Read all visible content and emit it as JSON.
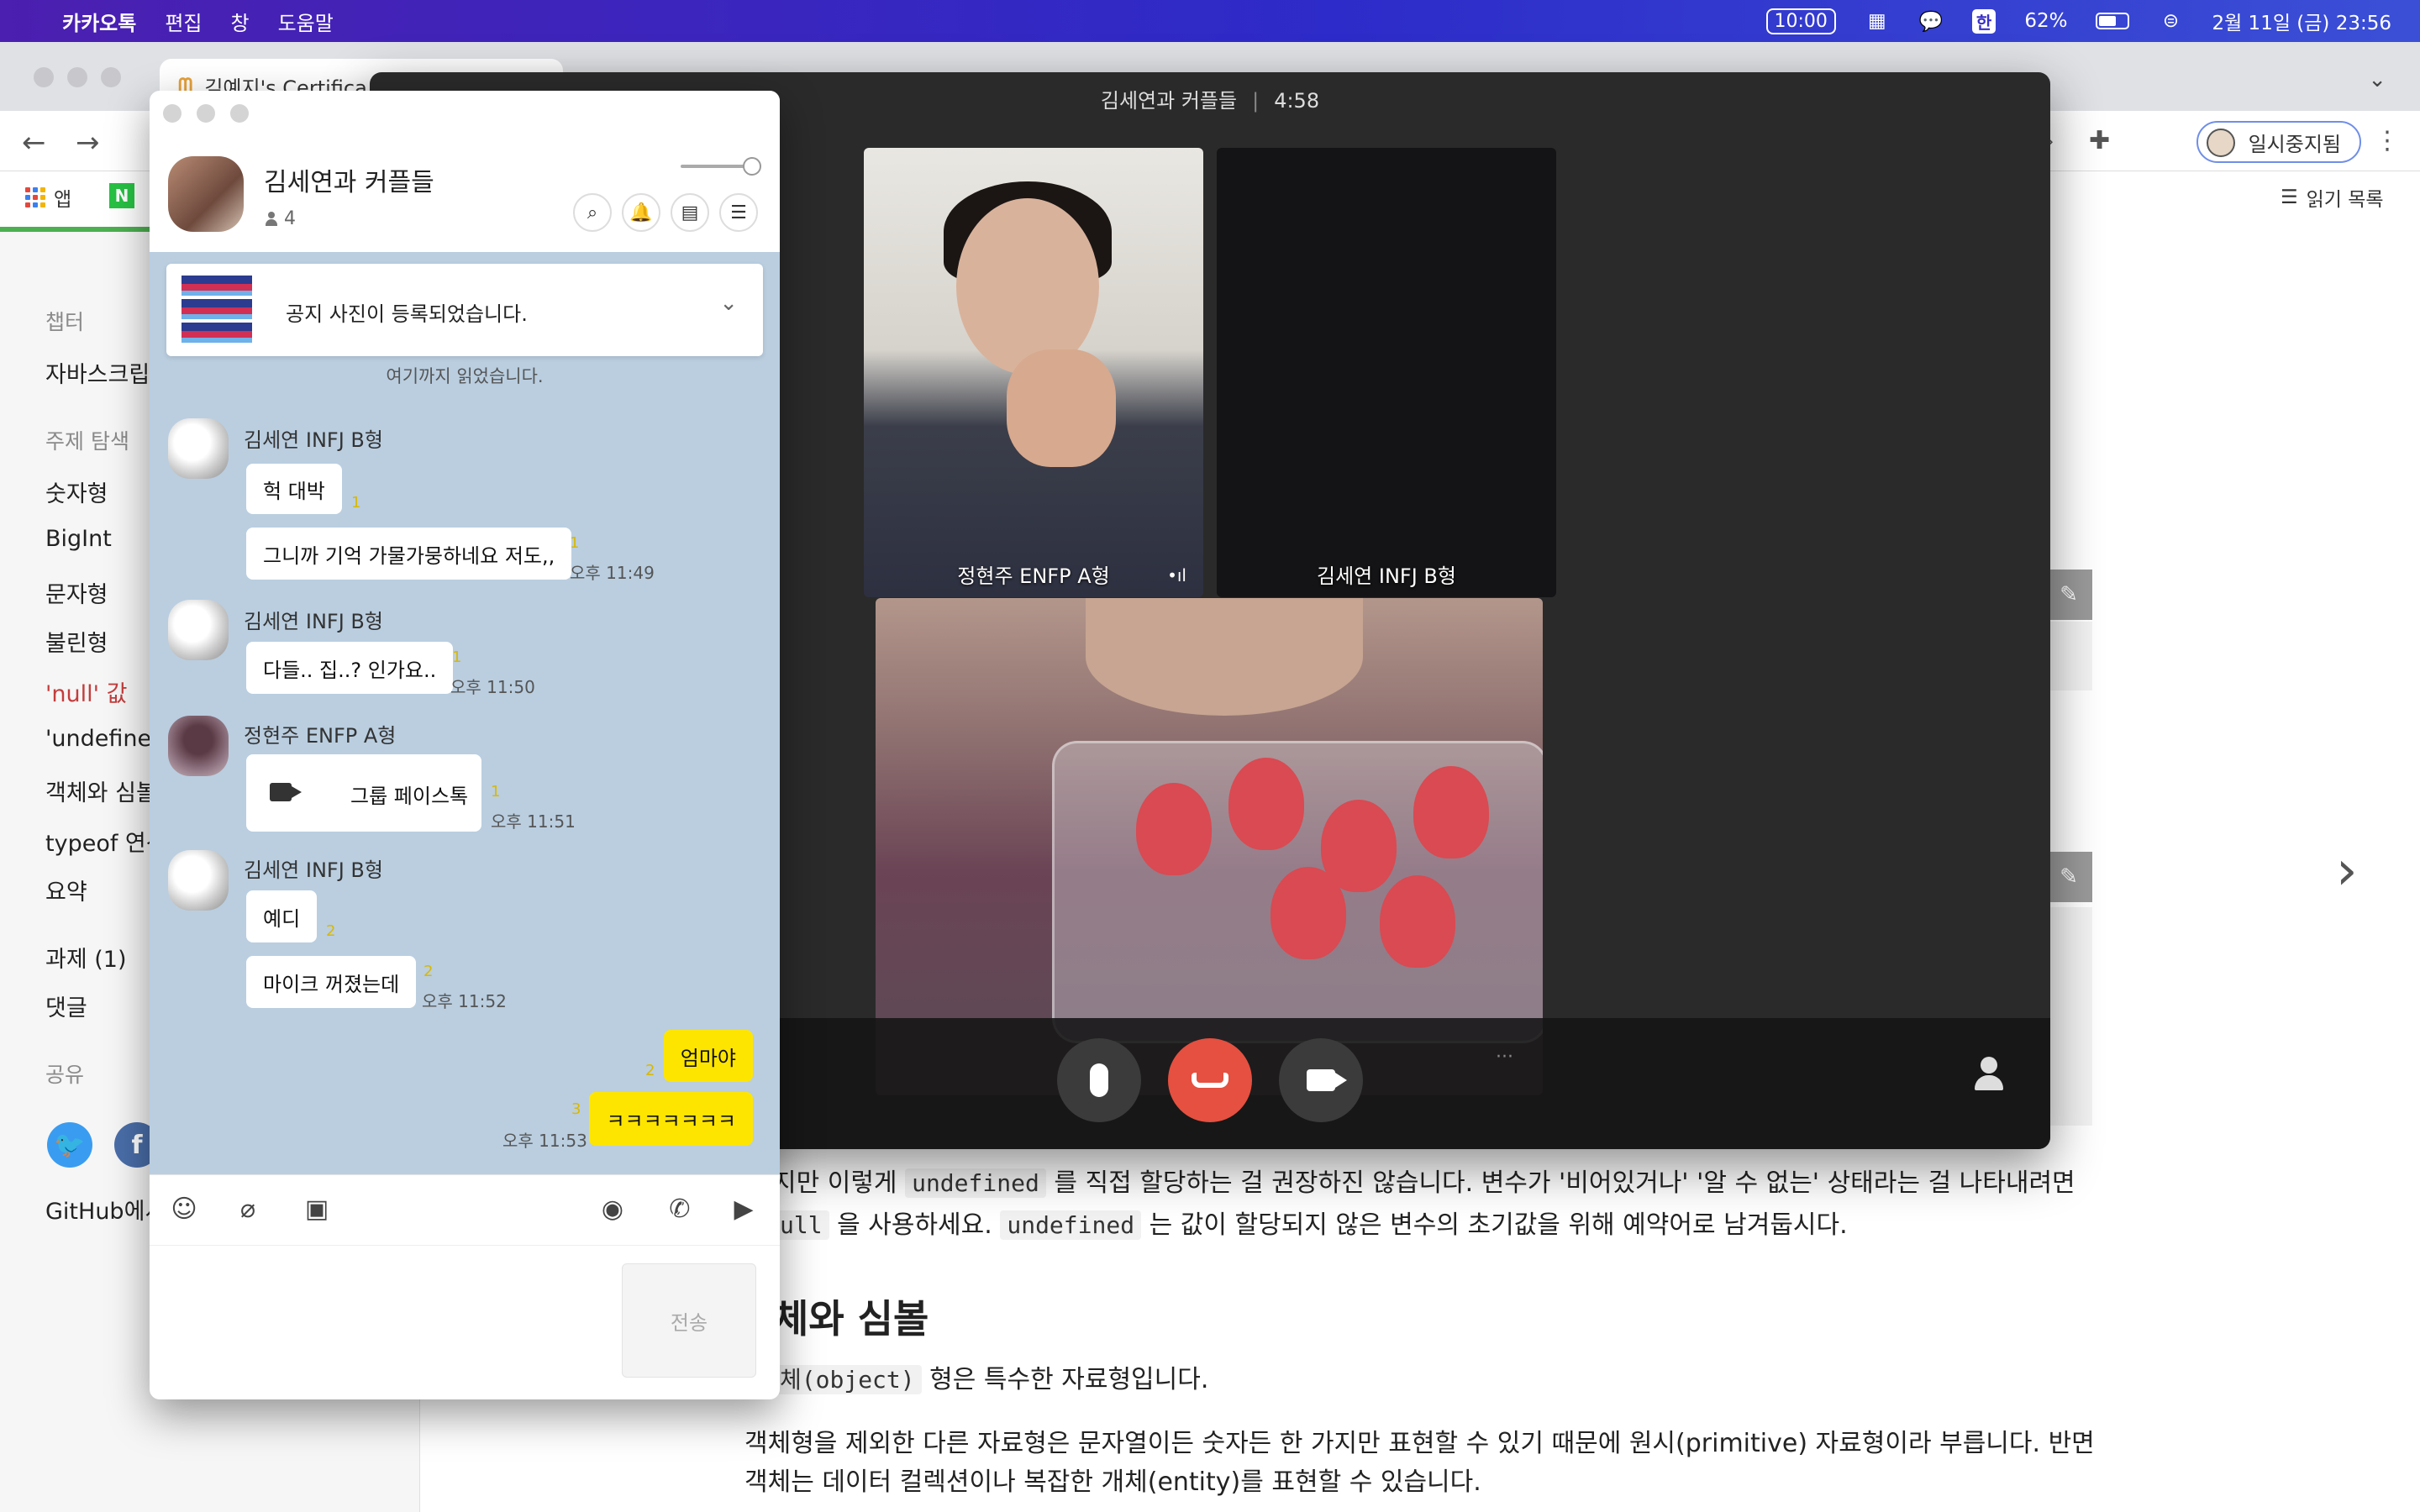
{
  "menubar": {
    "app_name": "카카오톡",
    "menus": [
      "편집",
      "창",
      "도움말"
    ],
    "time_box": "10:00",
    "battery": "62%",
    "ime": "한",
    "datetime": "2월 11일 (금)  23:56"
  },
  "browser": {
    "tab_title": "김예지's Certifica",
    "paused_label": "일시중지됨",
    "bookmarks": {
      "apps": "앱",
      "naver": "N",
      "reading_list": "읽기 목록"
    }
  },
  "sidebar": {
    "chapter_label": "챕터",
    "chapter": "자바스크립트",
    "topics_label": "주제 탐색",
    "topics": [
      "숫자형",
      "BigInt",
      "문자형",
      "불린형",
      "'null' 값",
      "'undefined'",
      "객체와 심볼",
      "typeof 연산자",
      "요약"
    ],
    "assignment": "과제 (1)",
    "comments": "댓글",
    "share_label": "공유",
    "github": "GitHub에서"
  },
  "article": {
    "p1_pre": "지만 이렇게",
    "p1_code": "undefined",
    "p1_post": "를 직접 할당하는 걸 권장하진 않습니다. 변수가 '비어있거나' '알 수 없는' 상태라는 걸 나타내려면",
    "p2_code1": "ull",
    "p2_mid": "을 사용하세요.",
    "p2_code2": "undefined",
    "p2_post": "는 값이 할당되지 않은 변수의 초기값을 위해 예약어로 남겨둡시다.",
    "heading": "체와 심볼",
    "p3_code": "체(object)",
    "p3_post": "형은 특수한 자료형입니다.",
    "p4": "객체형을 제외한 다른 자료형은 문자열이든 숫자든 한 가지만 표현할 수 있기 때문에 원시(primitive) 자료형이라 부릅니다. 반면",
    "p5": "객체는 데이터 컬렉션이나 복잡한 개체(entity)를 표현할 수 있습니다."
  },
  "facetalk": {
    "room": "김세연과 커플들",
    "duration": "4:58",
    "tiles": [
      {
        "label": "정현주 ENFP A형"
      },
      {
        "label": "김세연 INFJ B형"
      }
    ],
    "more": "···"
  },
  "chat": {
    "title": "김세연과 커플들",
    "member_count": "4",
    "notice": "공지 사진이 등록되었습니다.",
    "read_marker": "여기까지 읽었습니다.",
    "messages": [
      {
        "sender": "김세연 INFJ B형",
        "text": "헉 대박",
        "unread": "1"
      },
      {
        "text": "그니까 기억 가물가뭉하네요 저도,,",
        "unread": "1",
        "time": "오후 11:49"
      },
      {
        "sender": "김세연 INFJ B형",
        "text": "다들.. 집..? 인가요..",
        "unread": "1",
        "time": "오후 11:50"
      },
      {
        "sender": "정현주 ENFP A형",
        "text": "그룹 페이스톡",
        "unread": "1",
        "time": "오후 11:51"
      },
      {
        "sender": "김세연 INFJ B형",
        "text": "예디",
        "unread": "2"
      },
      {
        "text": "마이크 꺼졌는데",
        "unread": "2",
        "time": "오후 11:52"
      },
      {
        "text": "엄마야",
        "unread": "2",
        "mine": true
      },
      {
        "text": "ㅋㅋㅋㅋㅋㅋㅋ",
        "unread": "3",
        "time": "오후 11:53",
        "mine": true
      }
    ],
    "send": "전송"
  },
  "colors": {
    "menubar": "#3a2bc4",
    "chat_bg": "#bacee0",
    "my_bubble": "#fee500",
    "end_call": "#e55040",
    "active_topic": "#c43d3d"
  },
  "icons": [
    "apple-icon",
    "search-icon",
    "bell-icon",
    "drawer-icon",
    "menu-icon",
    "emoji-icon",
    "paperclip-icon",
    "calendar-icon",
    "voice-icon",
    "phone-icon",
    "video-icon",
    "mic-icon",
    "end-call-icon",
    "camera-icon",
    "person-icon"
  ]
}
